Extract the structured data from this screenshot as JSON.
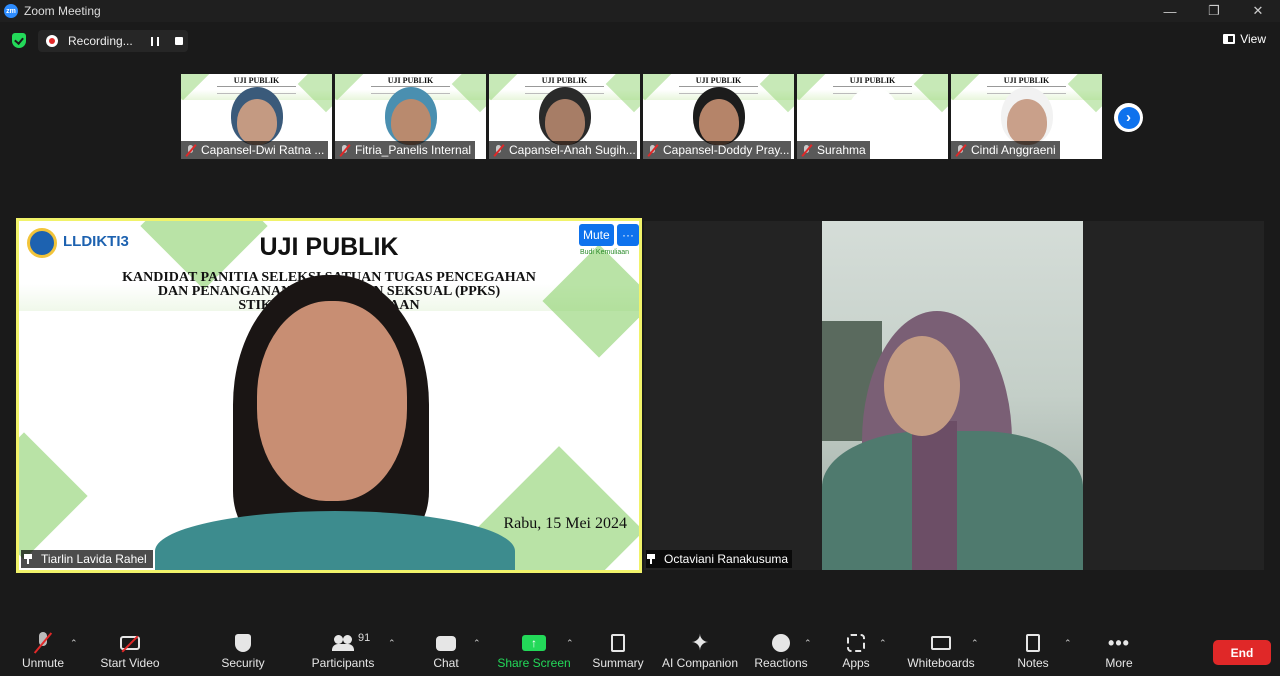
{
  "window": {
    "title": "Zoom Meeting",
    "logo": "zm"
  },
  "topbar": {
    "recording_label": "Recording...",
    "view_label": "View"
  },
  "thumbnails": [
    {
      "name": "Capansel-Dwi Ratna ...",
      "slide_title": "UJI PUBLIK",
      "skin": "#c49a82",
      "hair": "#3a5a7a"
    },
    {
      "name": "Fitria_Panelis Internal",
      "slide_title": "UJI PUBLIK",
      "skin": "#b98a6e",
      "hair": "#4a8fb0"
    },
    {
      "name": "Capansel-Anah Sugih...",
      "slide_title": "UJI PUBLIK",
      "skin": "#a77d66",
      "hair": "#2a2a2a"
    },
    {
      "name": "Capansel-Doddy Pray...",
      "slide_title": "UJI PUBLIK",
      "skin": "#b58469",
      "hair": "#1c1c1c"
    },
    {
      "name": "Surahma",
      "slide_title": "UJI PUBLIK",
      "skin": "#ffffff",
      "hair": "#ffffff"
    },
    {
      "name": "Cindi Anggraeni",
      "slide_title": "UJI PUBLIK",
      "skin": "#c9a08a",
      "hair": "#f2f2f2"
    }
  ],
  "speaker": {
    "name": "Tiarlin Lavida Rahel",
    "logo_text": "LLDIKTI3",
    "slide_title": "UJI PUBLIK",
    "slide_subtitle_1": "KANDIDAT PANITIA SELEKSI SATUAN TUGAS PENCEGAHAN",
    "slide_subtitle_2": "DAN PENANGANAN KEKERASAN SEKSUAL (PPKS)",
    "slide_subtitle_3": "STIKES BUDI KEMULIAAN",
    "brand": "Budi Kemuliaan",
    "date": "Rabu, 15 Mei 2024",
    "mute_label": "Mute",
    "more_label": "···"
  },
  "second_video": {
    "name": "Octaviani Ranakusuma"
  },
  "toolbar": {
    "unmute": "Unmute",
    "start_video": "Start Video",
    "security": "Security",
    "participants": "Participants",
    "participants_count": "91",
    "chat": "Chat",
    "share_screen": "Share Screen",
    "summary": "Summary",
    "ai_companion": "AI Companion",
    "reactions": "Reactions",
    "apps": "Apps",
    "whiteboards": "Whiteboards",
    "notes": "Notes",
    "more": "More",
    "end": "End"
  }
}
